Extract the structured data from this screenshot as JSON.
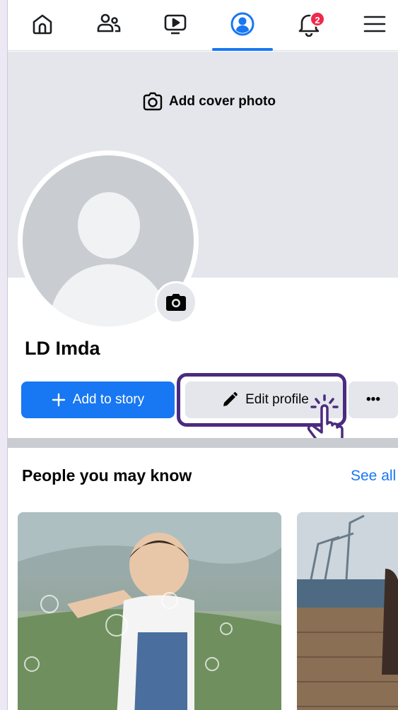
{
  "nav": {
    "items": [
      {
        "icon": "home-icon",
        "active": false
      },
      {
        "icon": "friends-icon",
        "active": false
      },
      {
        "icon": "video-icon",
        "active": false
      },
      {
        "icon": "profile-icon",
        "active": true
      },
      {
        "icon": "bell-icon",
        "active": false,
        "badge": "2"
      },
      {
        "icon": "menu-icon",
        "active": false
      }
    ],
    "notification_count": "2"
  },
  "cover": {
    "add_cover_label": "Add cover photo"
  },
  "profile": {
    "name": "LD Imda"
  },
  "actions": {
    "add_story_label": "Add to story",
    "edit_profile_label": "Edit profile",
    "more_label": "•••"
  },
  "people_you_may_know": {
    "title": "People you may know",
    "see_all_label": "See all"
  },
  "colors": {
    "brand_blue": "#1877f2",
    "badge_red": "#f02849",
    "highlight_purple": "#4b2b7f"
  }
}
